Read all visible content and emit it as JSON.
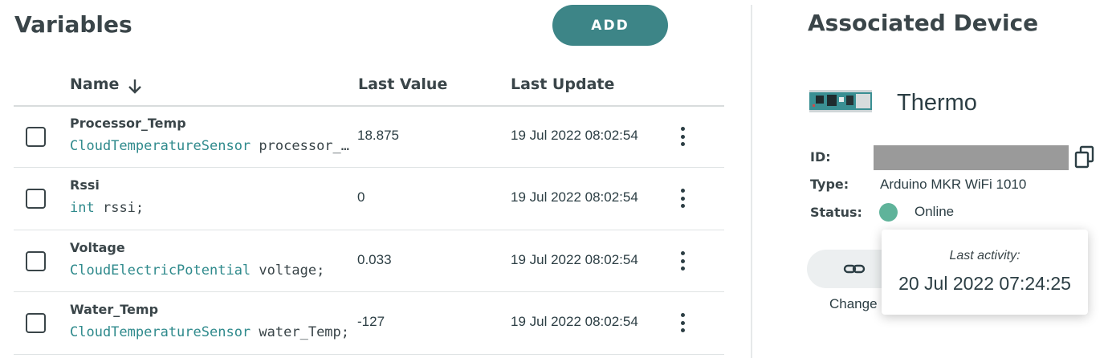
{
  "variables": {
    "title": "Variables",
    "add_label": "ADD",
    "columns": {
      "name": "Name",
      "last_value": "Last Value",
      "last_update": "Last Update"
    },
    "rows": [
      {
        "name": "Processor_Temp",
        "type": "CloudTemperatureSensor",
        "decl": "processor_Temp;",
        "value": "18.875",
        "updated": "19 Jul 2022 08:02:54"
      },
      {
        "name": "Rssi",
        "type": "int",
        "decl": "rssi;",
        "value": "0",
        "updated": "19 Jul 2022 08:02:54"
      },
      {
        "name": "Voltage",
        "type": "CloudElectricPotential",
        "decl": "voltage;",
        "value": "0.033",
        "updated": "19 Jul 2022 08:02:54"
      },
      {
        "name": "Water_Temp",
        "type": "CloudTemperatureSensor",
        "decl": "water_Temp;",
        "value": "-127",
        "updated": "19 Jul 2022 08:02:54"
      }
    ]
  },
  "device": {
    "title": "Associated Device",
    "name": "Thermo",
    "id_label": "ID:",
    "type_label": "Type:",
    "type_value": "Arduino MKR WiFi 1010",
    "status_label": "Status:",
    "status_value": "Online",
    "status_color": "#5fb39a",
    "change_label": "Change",
    "tooltip": {
      "label": "Last activity:",
      "value": "20 Jul 2022 07:24:25"
    }
  },
  "colors": {
    "accent": "#3d8587",
    "type_text": "#2f8a8c"
  },
  "icons": {
    "sort": "arrow-down-icon",
    "row_menu": "kebab-menu-icon",
    "copy": "copy-icon",
    "link": "link-icon",
    "board": "board-image"
  }
}
